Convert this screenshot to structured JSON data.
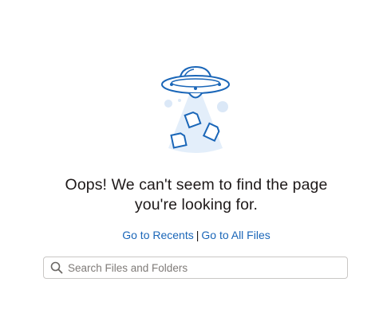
{
  "error": {
    "line1": "Oops! We can't seem to find the page",
    "line2": "you're looking for."
  },
  "links": {
    "recents": "Go to Recents",
    "separator": "|",
    "all_files": "Go to All Files"
  },
  "search": {
    "placeholder": "Search Files and Folders",
    "value": "",
    "icon": "search-icon"
  },
  "illustration": {
    "icon": "ufo-abducting-files-illustration"
  },
  "colors": {
    "link": "#1a66b8",
    "text": "#1e1919",
    "illustration_stroke": "#1a66b8",
    "illustration_fill": "#dbe8f7",
    "input_border": "#c9c7c5"
  }
}
